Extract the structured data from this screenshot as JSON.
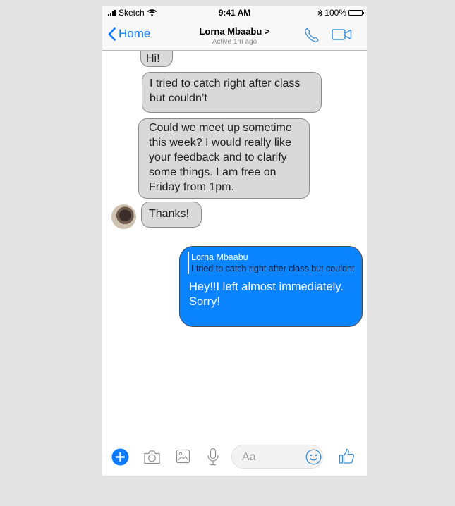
{
  "status_bar": {
    "carrier": "Sketch",
    "time": "9:41 AM",
    "battery": "100%"
  },
  "nav": {
    "back_label": "Home",
    "contact_name": "Lorna Mbaabu >",
    "status": "Active 1m ago",
    "accent_color": "#0a7aff"
  },
  "messages": [
    {
      "direction": "incoming",
      "text": "Hi!"
    },
    {
      "direction": "incoming",
      "text": "I tried to catch right after class but couldn’t"
    },
    {
      "direction": "incoming",
      "text": "Could we meet up sometime this week? I would really like your feedback and to clarify some things. I am free on Friday from 1pm."
    },
    {
      "direction": "incoming",
      "text": "Thanks!"
    },
    {
      "direction": "outgoing",
      "reply_to": {
        "name": "Lorna Mbaabu",
        "text": "I tried to catch right after class but couldnt"
      },
      "text": "Hey!!I left almost immediately. Sorry!"
    }
  ],
  "composer": {
    "placeholder": "Aa",
    "value": ""
  },
  "icons": {
    "add": "plus-circle-icon",
    "camera": "camera-icon",
    "gallery": "image-icon",
    "mic": "microphone-icon",
    "emoji": "smiley-icon",
    "like": "thumbs-up-icon"
  }
}
